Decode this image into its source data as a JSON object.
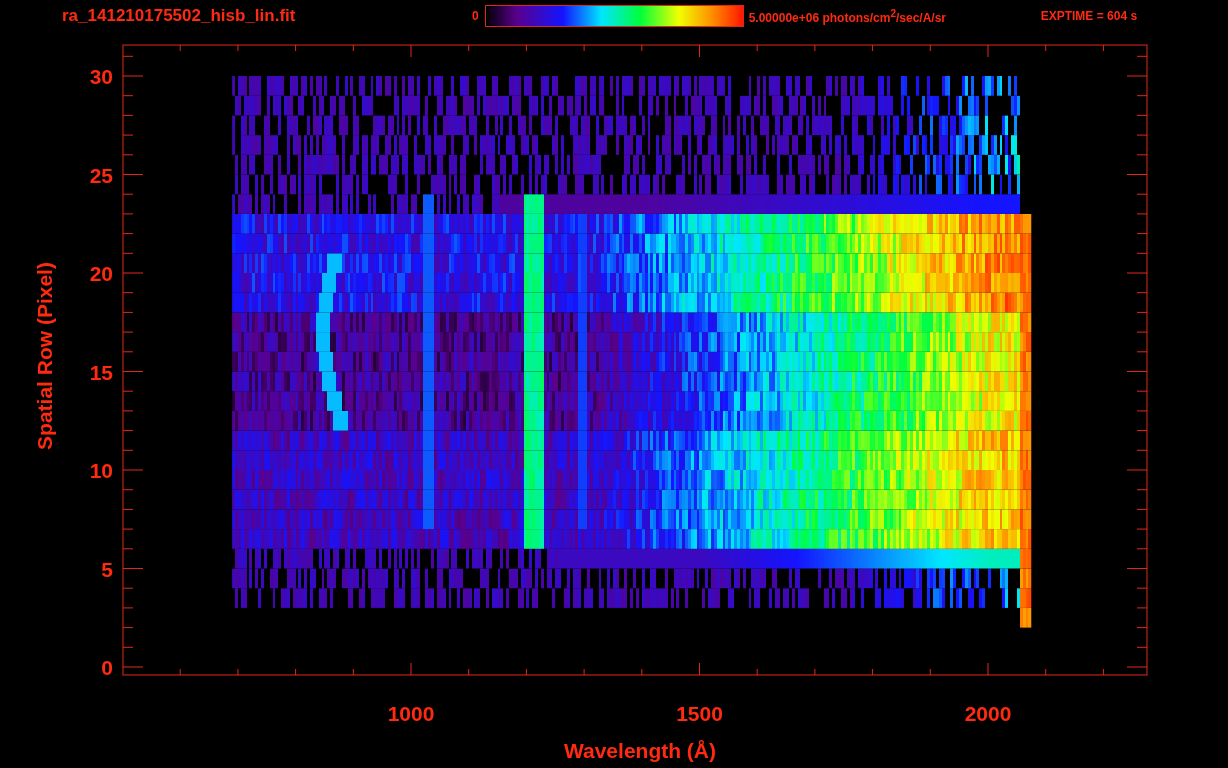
{
  "title": "ra_141210175502_hisb_lin.fit",
  "colorbar": {
    "min_label": "0",
    "max_label": "5.00000e+06 photons/cm$^{2}$/sec/A/sr"
  },
  "exposure": "EXPTIME = 604 s",
  "plot": {
    "xlabel": "Wavelength (Å)",
    "ylabel": "Spatial Row (Pixel)",
    "xticks": [
      "1000",
      "1500",
      "2000"
    ],
    "yticks": [
      "30",
      "25",
      "20",
      "15",
      "10",
      "5",
      "0"
    ]
  }
}
